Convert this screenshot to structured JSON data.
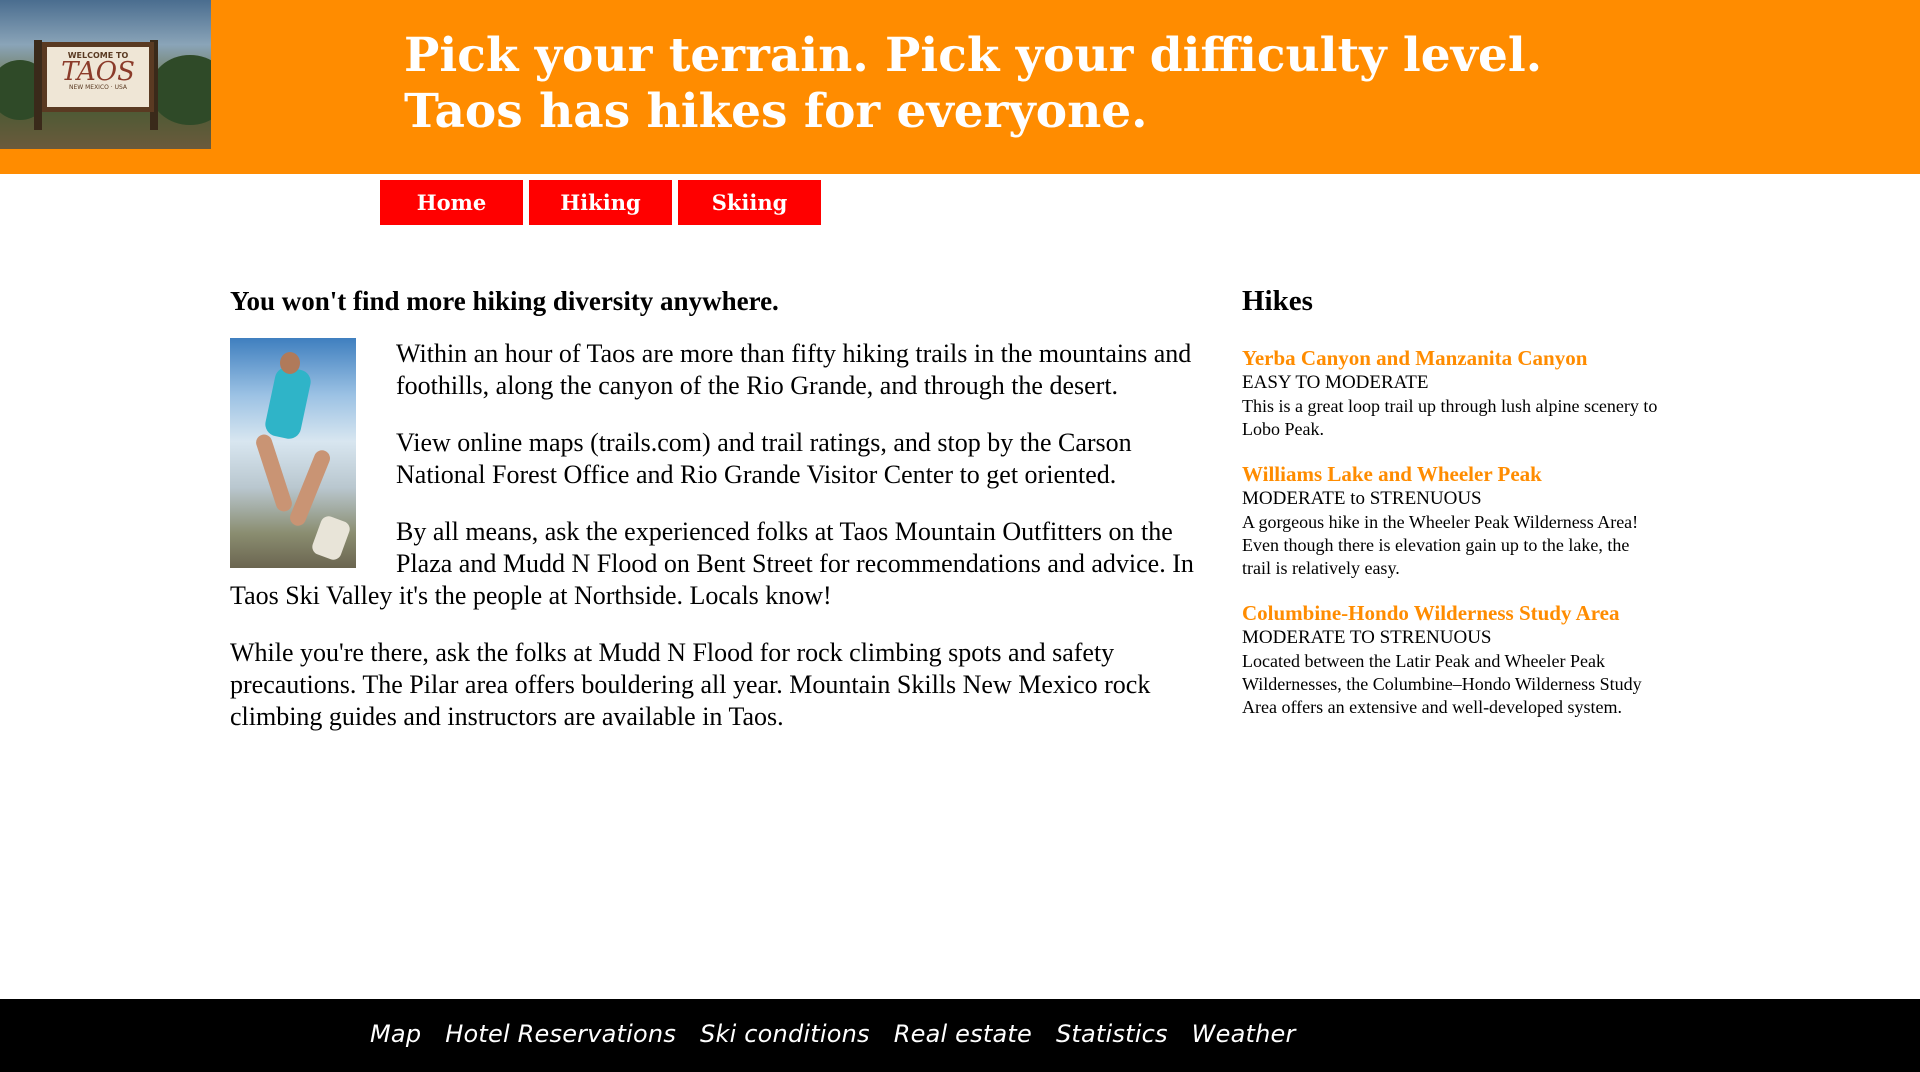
{
  "header": {
    "logo": {
      "welcome": "WELCOME TO",
      "name": "TAOS",
      "state": "NEW MEXICO · USA"
    },
    "headline_line1": "Pick your terrain. Pick your difficulty level.",
    "headline_line2": "Taos has hikes for everyone."
  },
  "nav": {
    "home": "Home",
    "hiking": "Hiking",
    "skiing": "Skiing"
  },
  "main": {
    "heading": "You won't find more hiking diversity anywhere.",
    "paragraphs": [
      "Within an hour of Taos are more than fifty hiking trails in the mountains and foothills, along the canyon of the Rio Grande, and through the desert.",
      "View online maps (trails.com) and trail ratings, and stop by the Carson National Forest Office and Rio Grande Visitor Center to get oriented.",
      "By all means, ask the experienced folks at Taos Mountain Outfitters on the Plaza and Mudd N Flood on Bent Street for recommendations and advice. In Taos Ski Valley it's the people at Northside. Locals know!",
      "While you're there, ask the folks at Mudd N Flood for rock climbing spots and safety precautions. The Pilar area offers bouldering all year. Mountain Skills New Mexico rock climbing guides and instructors are available in Taos."
    ]
  },
  "sidebar": {
    "title": "Hikes",
    "hikes": [
      {
        "name": "Yerba Canyon and Manzanita Canyon",
        "level": "EASY TO MODERATE",
        "desc": "This is a great loop trail up through lush alpine scenery to Lobo Peak."
      },
      {
        "name": "Williams Lake and Wheeler Peak",
        "level": "MODERATE to STRENUOUS",
        "desc": "A gorgeous hike in the Wheeler Peak Wilderness Area! Even though there is elevation gain up to the lake, the trail is relatively easy."
      },
      {
        "name": "Columbine-Hondo Wilderness Study Area",
        "level": "MODERATE TO STRENUOUS",
        "desc": "Located between the Latir Peak and Wheeler Peak Wildernesses, the Columbine–Hondo Wilderness Study Area offers an extensive and well-developed system."
      }
    ]
  },
  "footer": {
    "links": [
      "Map",
      "Hotel Reservations",
      "Ski conditions",
      "Real estate",
      "Statistics",
      "Weather"
    ]
  },
  "colors": {
    "header_bg": "#ff8c00",
    "nav_bg": "#ff0000",
    "link_orange": "#ff8c00",
    "footer_bg": "#000000"
  }
}
